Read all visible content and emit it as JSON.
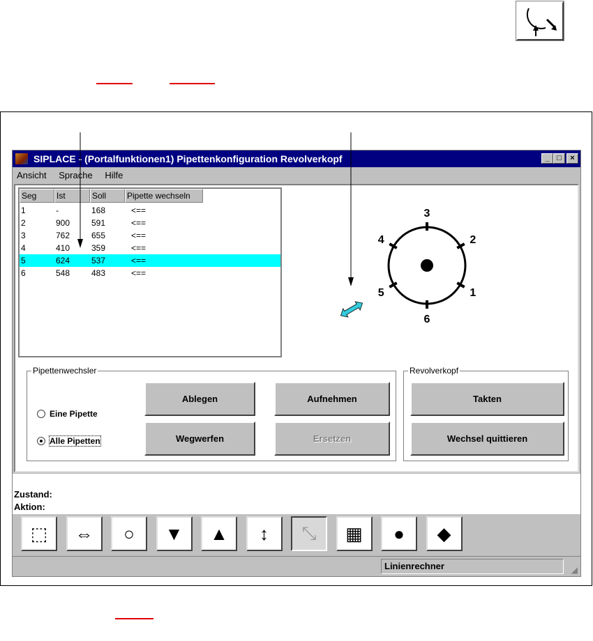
{
  "document": {
    "corner_icon": "revolver-change-icon"
  },
  "window": {
    "title": "SIPLACE - (Portalfunktionen1) Pipettenkonfiguration Revolverkopf",
    "controls": [
      "_",
      "□",
      "×"
    ],
    "menu": [
      "Ansicht",
      "Sprache",
      "Hilfe"
    ]
  },
  "table": {
    "headers": [
      "Seg",
      "Ist",
      "Soll",
      "Pipette wechseln"
    ],
    "rows": [
      [
        "1",
        "-",
        "168",
        "<=="
      ],
      [
        "2",
        "900",
        "591",
        "<=="
      ],
      [
        "3",
        "762",
        "655",
        "<=="
      ],
      [
        "4",
        "410",
        "359",
        "<=="
      ],
      [
        "5",
        "624",
        "537",
        "<=="
      ],
      [
        "6",
        "548",
        "483",
        "<=="
      ]
    ],
    "selected_row": 5
  },
  "revolver": {
    "segments": [
      "1",
      "2",
      "3",
      "4",
      "5",
      "6"
    ],
    "accent": "#33ccdd"
  },
  "pipettenwechsler": {
    "label": "Pipettenwechsler",
    "radio_one": "Eine Pipette",
    "radio_all": "Alle Pipetten",
    "selected": "Alle Pipetten",
    "buttons": {
      "ablegen": "Ablegen",
      "aufnehmen": "Aufnehmen",
      "wegwerfen": "Wegwerfen",
      "ersetzen": "Ersetzen"
    }
  },
  "revolverkopf": {
    "label": "Revolverkopf",
    "takten": "Takten",
    "quittieren": "Wechsel quittieren"
  },
  "status": {
    "zustand": "Zustand:",
    "aktion": "Aktion:"
  },
  "toolbar": [
    "select-icon",
    "portal-move-icon",
    "revolver-icon",
    "nozzle-down-icon",
    "nozzle-up-icon",
    "nozzle-height-icon",
    "revolver-change-icon",
    "feeder-icon",
    "conveyor-icon",
    "dispense-icon"
  ],
  "statusbar": {
    "panel": "Linienrechner"
  }
}
